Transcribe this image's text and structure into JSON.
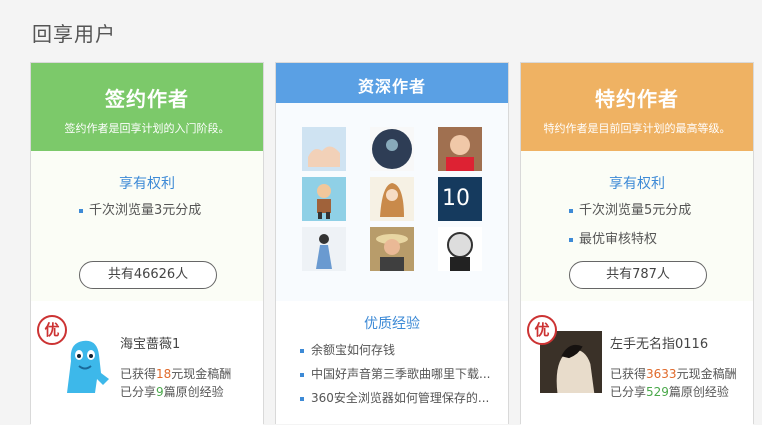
{
  "page": {
    "section_title": "回享用户"
  },
  "signed": {
    "title": "签约作者",
    "subtitle": "签约作者是回享计划的入门阶段。",
    "benefit_title": "享有权利",
    "benefits": [
      "千次浏览量3元分成"
    ],
    "count_label": "共有46626人",
    "badge": "优",
    "user": {
      "name": "海宝蔷薇1",
      "stat1_pre": "已获得",
      "stat1_num": "18",
      "stat1_post": "元现金稿酬",
      "stat2_pre": "已分享",
      "stat2_num": "9",
      "stat2_post": "篇原创经验"
    }
  },
  "senior": {
    "title": "资深作者",
    "exp_title": "优质经验",
    "exp_items": [
      "余额宝如何存钱",
      "中国好声音第三季歌曲哪里下载...",
      "360安全浏览器如何管理保存的..."
    ]
  },
  "special": {
    "title": "特约作者",
    "subtitle": "特约作者是目前回享计划的最高等级。",
    "benefit_title": "享有权利",
    "benefits": [
      "千次浏览量5元分成",
      "最优审核特权"
    ],
    "count_label": "共有787人",
    "badge": "优",
    "user": {
      "name": "左手无名指0116",
      "stat1_pre": "已获得",
      "stat1_num": "3633",
      "stat1_post": "元现金稿酬",
      "stat2_pre": "已分享",
      "stat2_num": "529",
      "stat2_post": "篇原创经验"
    }
  },
  "colors": {
    "green": "#7cc96a",
    "blue": "#5aa0e4",
    "orange": "#efb263",
    "link": "#3d8ad6"
  }
}
